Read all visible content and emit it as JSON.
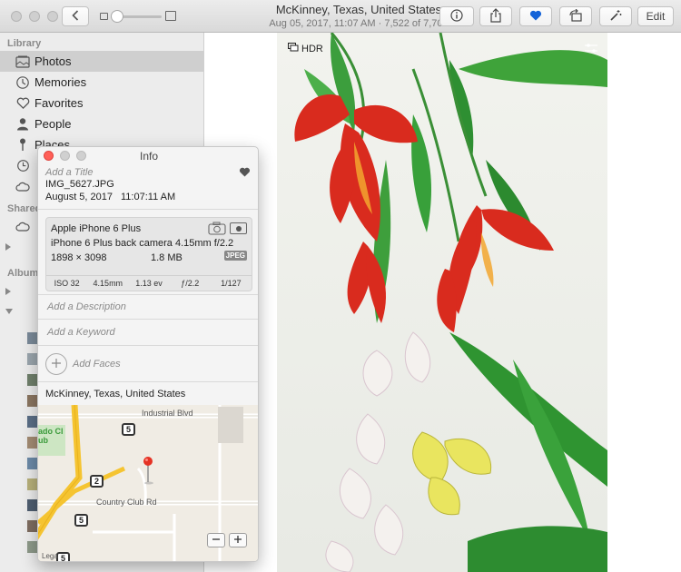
{
  "toolbar": {
    "title": "McKinney, Texas, United States",
    "subtitle": "Aug 05, 2017, 11:07 AM  ·  7,522 of 7,704",
    "edit_label": "Edit",
    "back_icon": "chevron-left-icon",
    "favorite_color": "#1463d8"
  },
  "sidebar": {
    "library_header": "Library",
    "items": [
      {
        "label": "Photos",
        "icon": "photos-icon"
      },
      {
        "label": "Memories",
        "icon": "memories-icon"
      },
      {
        "label": "Favorites",
        "icon": "heart-icon"
      },
      {
        "label": "People",
        "icon": "person-icon"
      },
      {
        "label": "Places",
        "icon": "pin-icon"
      }
    ],
    "shared_header": "Shared",
    "albums_header": "Albums"
  },
  "photo": {
    "hdr_label": "HDR"
  },
  "info": {
    "window_title": "Info",
    "add_title": "Add a Title",
    "filename": "IMG_5627.JPG",
    "date": "August 5, 2017",
    "time": "11:07:11 AM",
    "camera": "Apple iPhone 6 Plus",
    "lens": "iPhone 6 Plus back camera 4.15mm f/2.2",
    "dimensions": "1898 × 3098",
    "filesize": "1.8 MB",
    "format": "JPEG",
    "specs": [
      "ISO 32",
      "4.15mm",
      "1.13 ev",
      "ƒ/2.2",
      "1/127"
    ],
    "add_description": "Add a Description",
    "add_keyword": "Add a Keyword",
    "add_faces": "Add Faces",
    "location": "McKinney, Texas, United States",
    "map": {
      "road1": "Industrial Blvd",
      "road2": "Country Club Rd",
      "poi": "ado Club",
      "badges": [
        "5",
        "2",
        "5",
        "5"
      ],
      "legal": "Lega"
    },
    "close_color": "#ff5f57"
  }
}
